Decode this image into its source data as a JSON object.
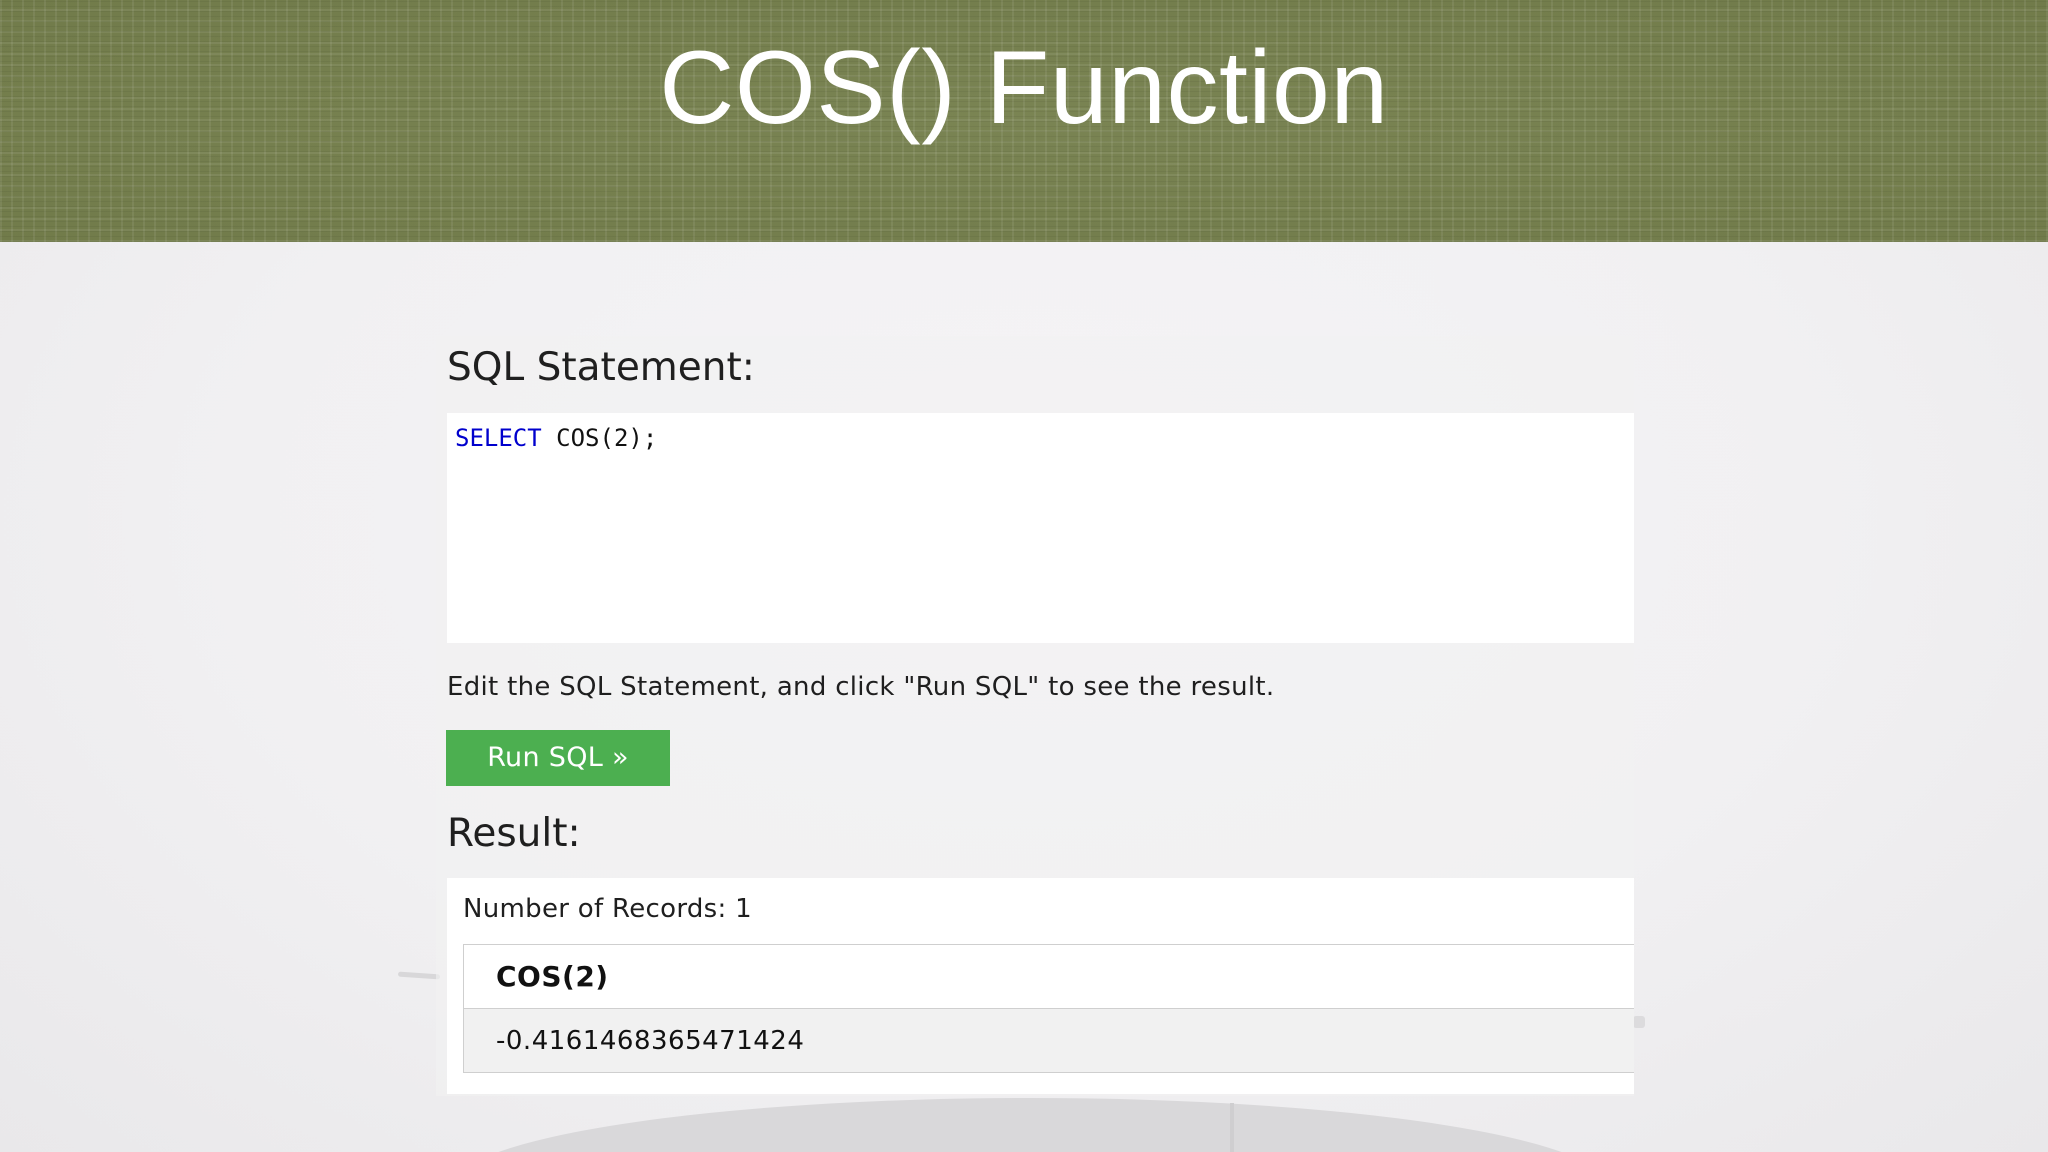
{
  "banner": {
    "title": "COS() Function"
  },
  "editor": {
    "heading": "SQL Statement:",
    "code_keyword": "SELECT",
    "code_rest": " COS(2);",
    "instruction": "Edit the SQL Statement, and click \"Run SQL\" to see the result.",
    "run_button_label": "Run SQL »"
  },
  "result": {
    "heading": "Result:",
    "record_count": "Number of Records: 1",
    "columns": [
      "COS(2)"
    ],
    "rows": [
      [
        "-0.4161468365471424"
      ]
    ]
  },
  "colors": {
    "banner_bg": "#76804f",
    "button_bg": "#4caf50",
    "keyword": "#0000cd"
  }
}
